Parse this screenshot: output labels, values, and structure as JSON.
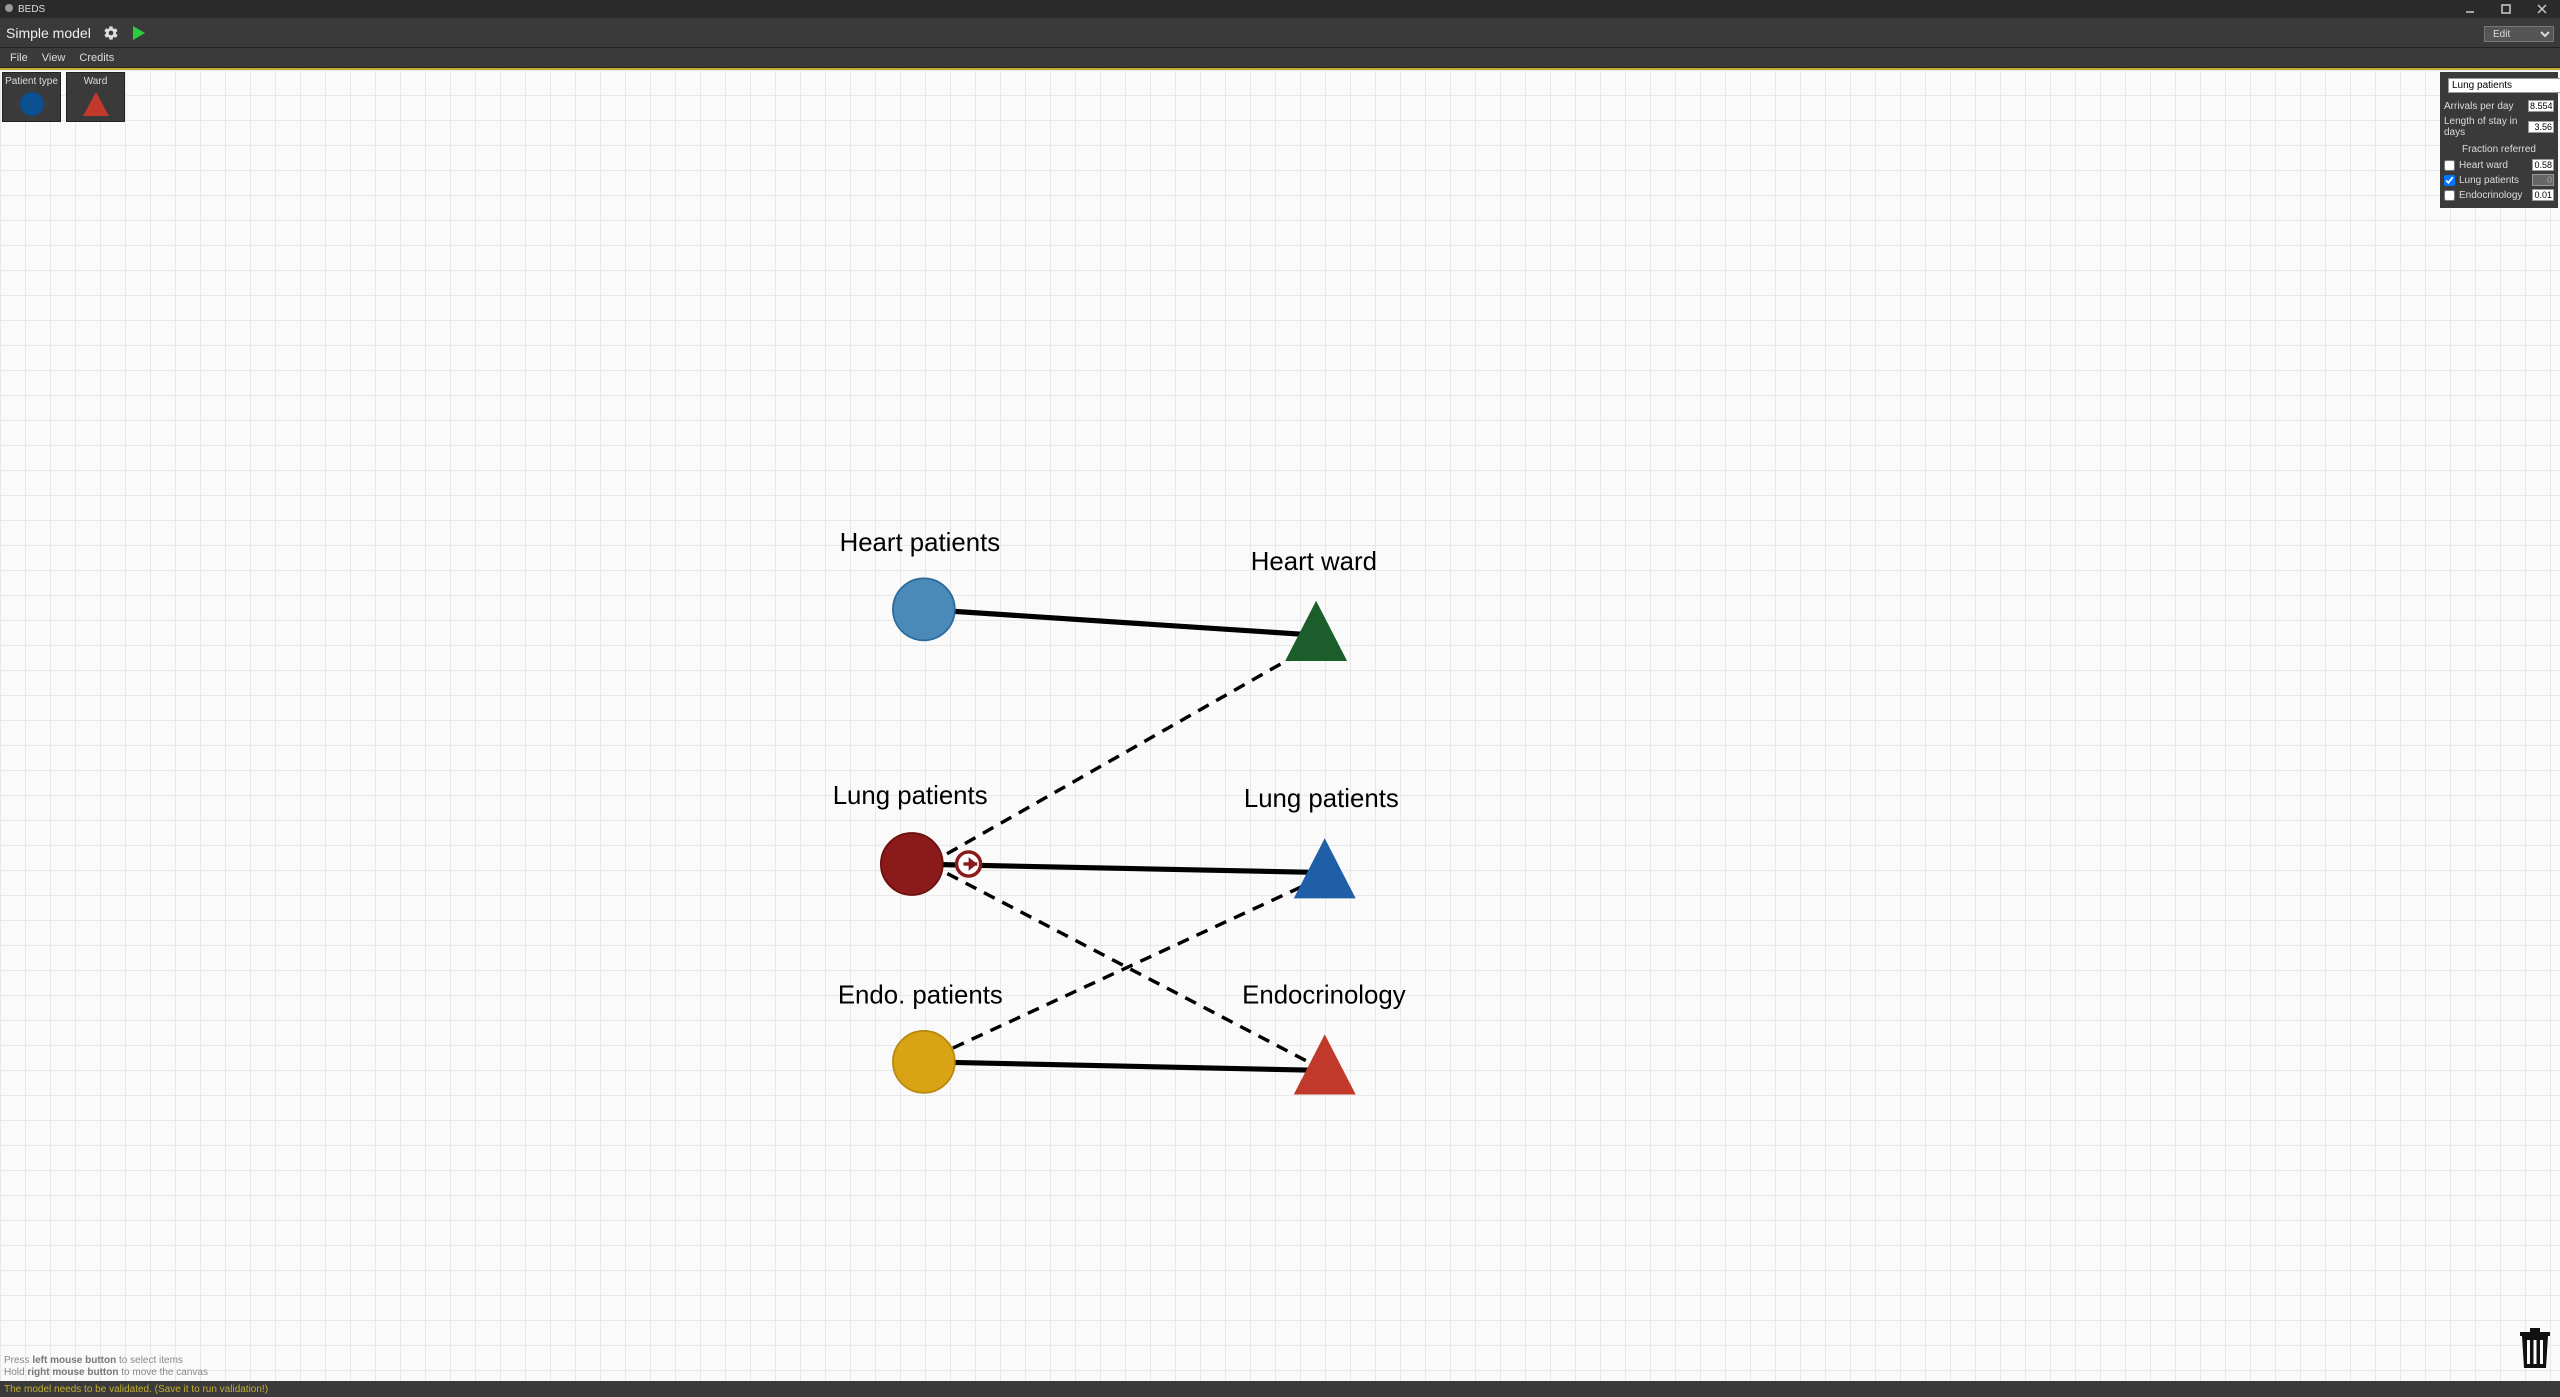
{
  "window": {
    "app_name": "BEDS"
  },
  "toolbar": {
    "title": "Simple model",
    "mode": "Edit"
  },
  "menu": {
    "file": "File",
    "view": "View",
    "credits": "Credits"
  },
  "palette": {
    "patient_type": "Patient type",
    "ward": "Ward"
  },
  "nodes": {
    "heart_patients": "Heart patients",
    "lung_patients_src": "Lung patients",
    "endo_patients": "Endo. patients",
    "heart_ward": "Heart ward",
    "lung_patients_dst": "Lung patients",
    "endocrinology": "Endocrinology"
  },
  "inspector": {
    "name": "Lung patients",
    "arrivals_label": "Arrivals per day",
    "arrivals_value": "8.554",
    "los_label": "Length of stay in days",
    "los_value": "3.56",
    "fraction_header": "Fraction referred",
    "rows": [
      {
        "label": "Heart ward",
        "checked": false,
        "value": "0.58",
        "disabled": false
      },
      {
        "label": "Lung patients",
        "checked": true,
        "value": "0",
        "disabled": true
      },
      {
        "label": "Endocrinology",
        "checked": false,
        "value": "0.01",
        "disabled": false
      }
    ]
  },
  "hints": {
    "l1a": "Press ",
    "l1b": "left mouse button",
    "l1c": " to select items",
    "l2a": "Hold ",
    "l2b": "right mouse button",
    "l2c": " to move the canvas"
  },
  "status": "The model needs to be validated. (Save it to run validation!)"
}
